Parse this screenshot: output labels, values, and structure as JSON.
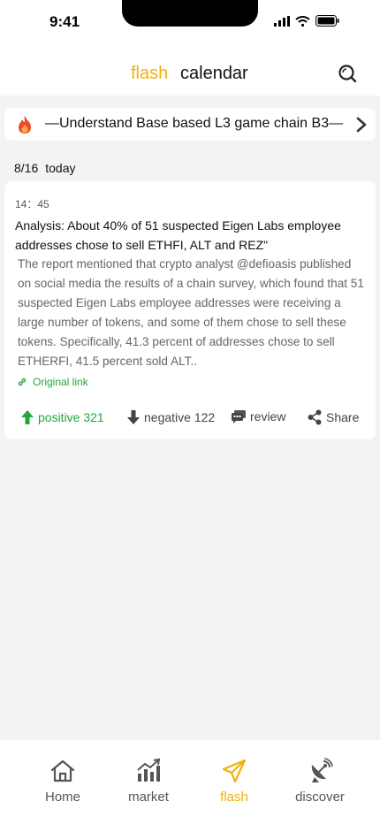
{
  "status": {
    "time": "9:41"
  },
  "header": {
    "tabs": [
      {
        "label": "flash",
        "active": true
      },
      {
        "label": "calendar",
        "active": false
      }
    ],
    "search_icon": "search-icon"
  },
  "banner": {
    "text": "—Understand Base based L3 game chain B3—",
    "icon": "fire-icon"
  },
  "date": {
    "day": "8/16",
    "label": "today"
  },
  "news": {
    "time": "14：45",
    "title": "Analysis: About 40% of 51 suspected Eigen Labs employee addresses chose to sell ETHFI, ALT and REZ\"",
    "body": "The report mentioned that crypto analyst @defioasis published on social media the results of a chain survey, which found that 51 suspected Eigen Labs employee addresses were receiving a large number of tokens, and some of them chose to sell these tokens. Specifically, 41.3 percent of addresses chose to sell ETHERFI, 41.5 percent sold ALT..",
    "link_label": "Original link",
    "actions": {
      "positive": "positive 321",
      "negative": "negative 122",
      "review": "review",
      "share": "Share"
    }
  },
  "tabbar": {
    "items": [
      {
        "label": "Home",
        "icon": "home-icon"
      },
      {
        "label": "market",
        "icon": "chart-icon"
      },
      {
        "label": "flash",
        "icon": "paper-plane-icon",
        "active": true
      },
      {
        "label": "discover",
        "icon": "satellite-icon"
      }
    ]
  },
  "colors": {
    "accent": "#f2b10a",
    "positive": "#22a63a",
    "background": "#f3f3f3"
  }
}
